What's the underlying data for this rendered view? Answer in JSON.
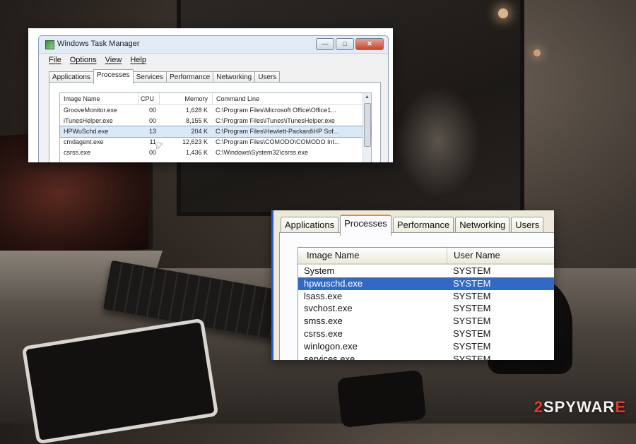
{
  "task_manager_window": {
    "title": "Windows Task Manager",
    "menu": [
      "File",
      "Options",
      "View",
      "Help"
    ],
    "tabs": [
      "Applications",
      "Processes",
      "Services",
      "Performance",
      "Networking",
      "Users"
    ],
    "active_tab": "Processes",
    "columns": [
      "Image Name",
      "CPU",
      "Memory",
      "Command Line"
    ],
    "rows": [
      {
        "image": "GrooveMonitor.exe",
        "cpu": "00",
        "memory": "1,628 K",
        "command": "C:\\Program Files\\Microsoft Office\\Office1..."
      },
      {
        "image": "iTunesHelper.exe",
        "cpu": "00",
        "memory": "8,155 K",
        "command": "C:\\Program Files\\iTunes\\iTunesHelper.exe"
      },
      {
        "image": "HPWuSchd.exe",
        "cpu": "13",
        "memory": "204 K",
        "command": "C:\\Program Files\\Hewlett-Packard\\HP Sof..."
      },
      {
        "image": "cmdagent.exe",
        "cpu": "11",
        "memory": "12,623 K",
        "command": "C:\\Program Files\\COMODO\\COMODO Int..."
      },
      {
        "image": "csrss.exe",
        "cpu": "00",
        "memory": "1,436 K",
        "command": "C:\\Windows\\System32\\csrss.exe"
      }
    ]
  },
  "processes_zoom": {
    "tabs": [
      "Applications",
      "Processes",
      "Performance",
      "Networking",
      "Users"
    ],
    "active_tab": "Processes",
    "columns": [
      "Image Name",
      "User Name"
    ],
    "rows": [
      {
        "image": "System",
        "user": "SYSTEM"
      },
      {
        "image": "hpwuschd.exe",
        "user": "SYSTEM"
      },
      {
        "image": "lsass.exe",
        "user": "SYSTEM"
      },
      {
        "image": "svchost.exe",
        "user": "SYSTEM"
      },
      {
        "image": "smss.exe",
        "user": "SYSTEM"
      },
      {
        "image": "csrss.exe",
        "user": "SYSTEM"
      },
      {
        "image": "winlogon.exe",
        "user": "SYSTEM"
      },
      {
        "image": "services.exe",
        "user": "SYSTEM"
      }
    ]
  },
  "watermark": {
    "prefix": "2",
    "name": "SPYWAR",
    "suffix": "E"
  },
  "colors": {
    "selection": "#316ac5",
    "active_tab_accent": "#e68b2c",
    "watermark_accent": "#e13b30"
  }
}
